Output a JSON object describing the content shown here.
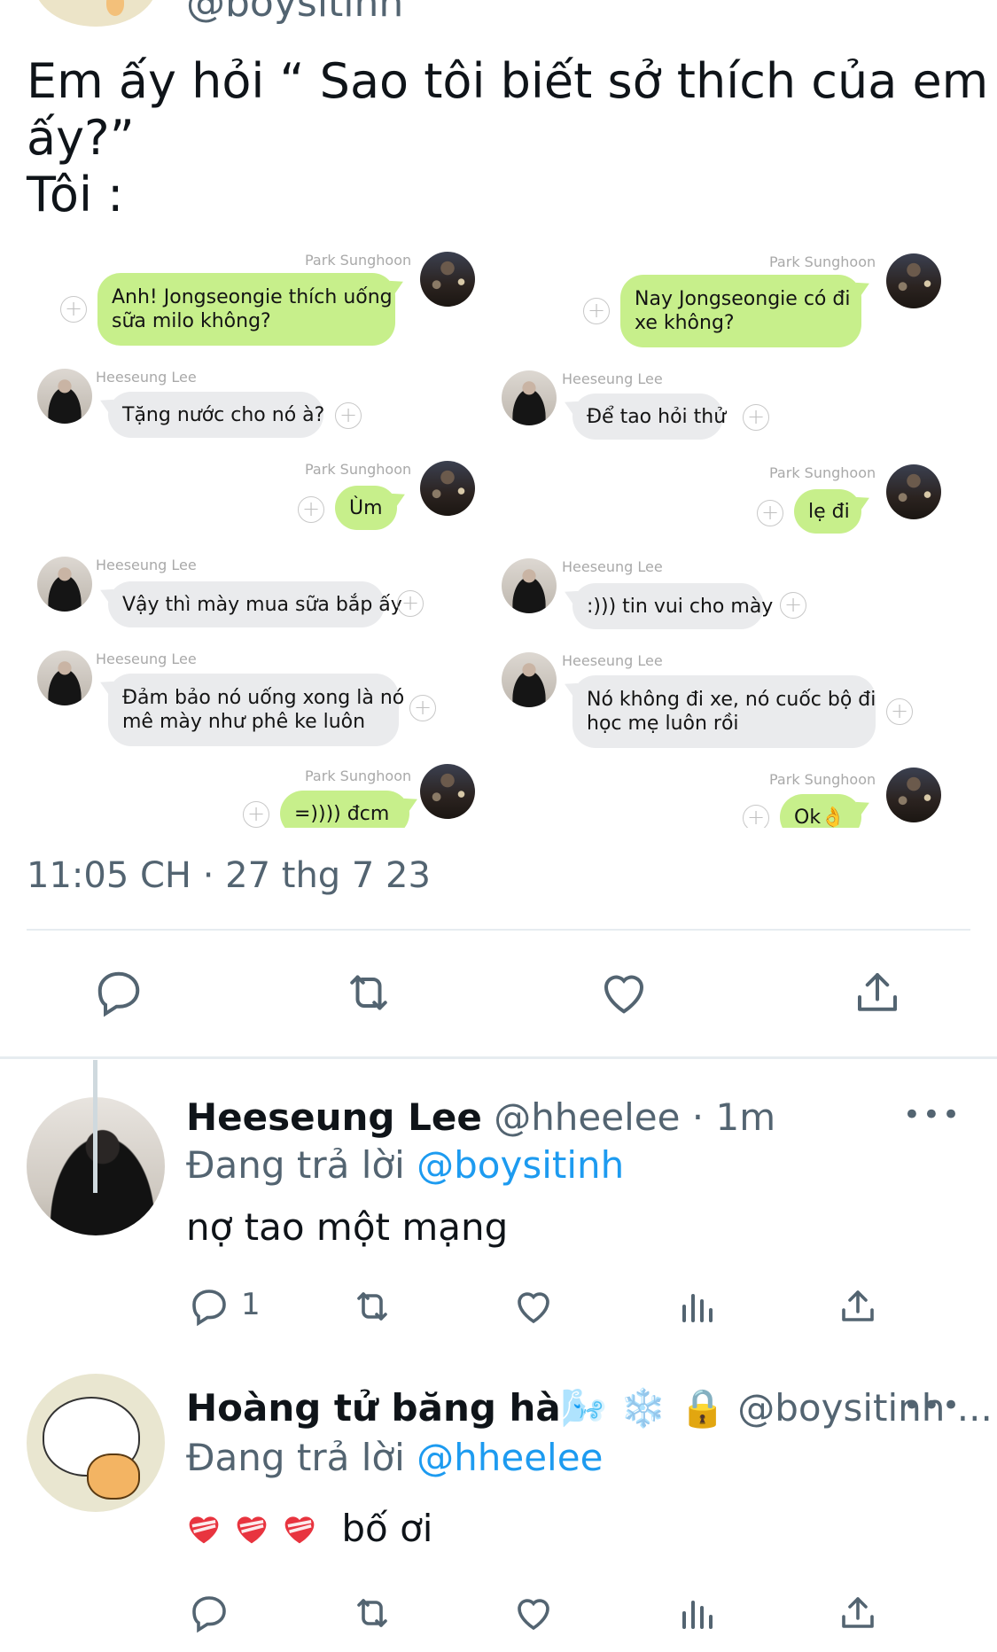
{
  "header": {
    "handle": "@boysitinh"
  },
  "tweet": {
    "line1": "Em ấy hỏi “ Sao tôi biết sở thích của em",
    "line2": "ấy?”",
    "line3": "Tôi :"
  },
  "chat": {
    "left": {
      "m1": {
        "sender": "Park Sunghoon",
        "text": "Anh! Jongseongie thích uống\nsữa milo không?"
      },
      "m2": {
        "sender": "Heeseung Lee",
        "text": "Tặng nước cho nó à?"
      },
      "m3": {
        "sender": "Park Sunghoon",
        "text": "Ùm"
      },
      "m4": {
        "sender": "Heeseung Lee",
        "text": "Vậy thì mày mua sữa bắp ấy"
      },
      "m5": {
        "sender": "Heeseung Lee",
        "text": "Đảm bảo nó uống xong là nó\nmê mày như phê ke luôn"
      },
      "m6": {
        "sender": "Park Sunghoon",
        "text": "=)))) đcm"
      }
    },
    "right": {
      "m1": {
        "sender": "Park Sunghoon",
        "text": "Nay Jongseongie có đi\nxe không?"
      },
      "m2": {
        "sender": "Heeseung Lee",
        "text": "Để tao hỏi thử"
      },
      "m3": {
        "sender": "Park Sunghoon",
        "text": "lẹ đi"
      },
      "m4": {
        "sender": "Heeseung Lee",
        "text": ":))) tin vui cho mày"
      },
      "m5": {
        "sender": "Heeseung Lee",
        "text": "Nó không đi xe, nó cuốc bộ đi\nhọc mẹ luôn rồi"
      },
      "m6": {
        "sender": "Park Sunghoon",
        "text": "Ok👌"
      }
    },
    "plus_glyph": "+"
  },
  "timestamp": "11:05 CH · 27 thg 7 23",
  "replies": [
    {
      "name": "Heeseung Lee",
      "handle_time": "@hheelee · 1m",
      "replying_prefix": "Đang trả lời",
      "replying_to": "@boysitinh",
      "text": "nợ tao một mạng",
      "reply_count": "1",
      "more": "•••"
    },
    {
      "name": "Hoàng tử băng hà🌬️ ❄️ 🔒",
      "handle_time": "@boysitinh ...",
      "replying_prefix": "Đang trả lời",
      "replying_to": "@hheelee",
      "text": "bố ơi",
      "more": "•••"
    }
  ],
  "colors": {
    "link": "#1d9bf0",
    "muted": "#536471",
    "chat_green": "#c7ef8b",
    "chat_gray": "#eaebed",
    "heart_red": "#e8343f"
  },
  "icons": [
    "comment-icon",
    "retweet-icon",
    "like-icon",
    "share-icon",
    "analytics-icon",
    "more-icon",
    "plus-icon"
  ]
}
